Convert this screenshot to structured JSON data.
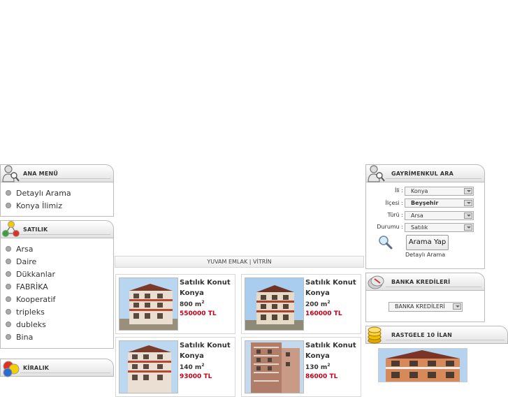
{
  "ana_menu": {
    "title": "ANA MENÜ",
    "items": [
      "Detaylı Arama",
      "Konya İlimiz"
    ]
  },
  "satilik": {
    "title": "SATILIK",
    "items": [
      "Arsa",
      "Daire",
      "Dükkanlar",
      "FABRİKA",
      "Kooperatif",
      "tripleks",
      "dubleks",
      "Bina"
    ]
  },
  "kiralik": {
    "title": "KİRALIK"
  },
  "search": {
    "title": "GAYRİMENKUL ARA",
    "il_label": "İli :",
    "il_value": "Konya",
    "ilce_label": "İlçesi :",
    "ilce_value": "Beyşehir",
    "tur_label": "Türü :",
    "tur_value": "Arsa",
    "durum_label": "Durumu :",
    "durum_value": "Satılık",
    "submit": "Arama Yap",
    "detail_link": "Detaylı Arama"
  },
  "banka": {
    "title": "BANKA KREDİLERİ",
    "select_value": "BANKA KREDİLERİ"
  },
  "rastgele": {
    "title": "RASTGELE 10 İLAN"
  },
  "vitrin": {
    "title": "YUVAM EMLAK | VİTRİN",
    "cards": [
      {
        "type": "Satılık Konut",
        "city": "Konya",
        "area": "800 m",
        "price": "550000 TL"
      },
      {
        "type": "Satılık Konut",
        "city": "Konya",
        "area": "200 m",
        "price": "160000 TL"
      },
      {
        "type": "Satılık Konut",
        "city": "Konya",
        "area": "140 m",
        "price": "93000 TL"
      },
      {
        "type": "Satılık Konut",
        "city": "Konya",
        "area": "130 m",
        "price": "86000 TL"
      }
    ],
    "area_sup": "2"
  },
  "colors": {
    "price": "#c00018",
    "panel_border": "#b9b9b9"
  },
  "icons": [
    "search-person-icon",
    "colored-balls-icon",
    "magnifier-icon",
    "coins-icon",
    "bullet-icon"
  ]
}
